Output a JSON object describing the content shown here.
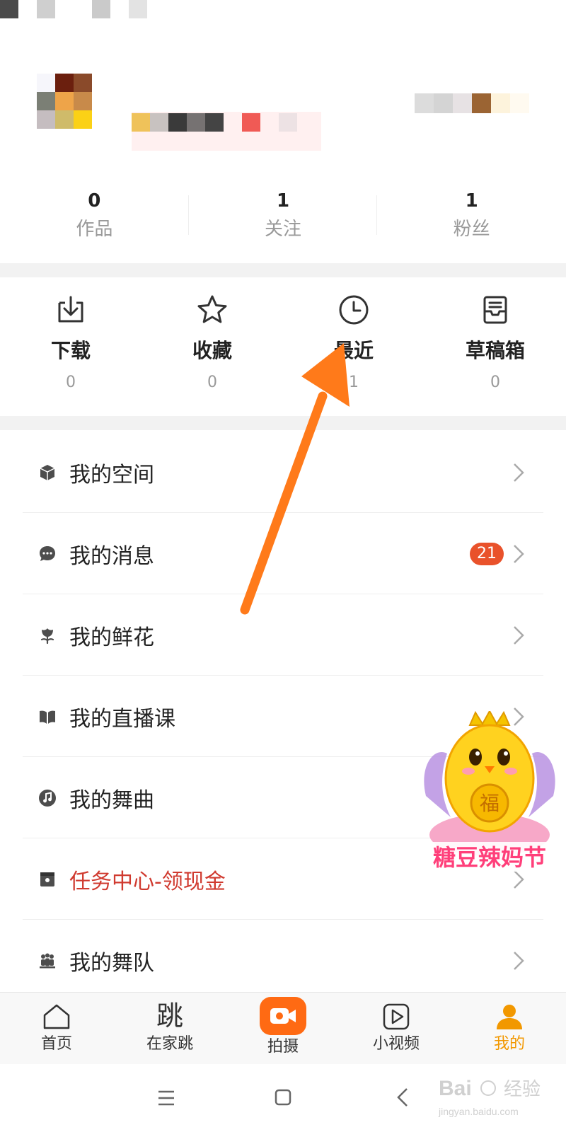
{
  "profile": {
    "stats": [
      {
        "value": "0",
        "label": "作品"
      },
      {
        "value": "1",
        "label": "关注"
      },
      {
        "value": "1",
        "label": "粉丝"
      }
    ]
  },
  "quick_actions": [
    {
      "label": "下载",
      "count": "0",
      "icon": "download-icon"
    },
    {
      "label": "收藏",
      "count": "0",
      "icon": "star-icon"
    },
    {
      "label": "最近",
      "count": "1",
      "icon": "clock-icon"
    },
    {
      "label": "草稿箱",
      "count": "0",
      "icon": "drafts-icon"
    }
  ],
  "menu": [
    {
      "label": "我的空间",
      "icon": "cube-icon"
    },
    {
      "label": "我的消息",
      "icon": "chat-icon",
      "badge": "21"
    },
    {
      "label": "我的鲜花",
      "icon": "flower-icon"
    },
    {
      "label": "我的直播课",
      "icon": "book-icon"
    },
    {
      "label": "我的舞曲",
      "icon": "music-icon"
    },
    {
      "label": "任务中心-领现金",
      "icon": "task-icon",
      "highlight_color": "#d03a2f"
    },
    {
      "label": "我的舞队",
      "icon": "team-icon"
    }
  ],
  "tabbar": [
    {
      "label": "首页",
      "icon": "home-icon"
    },
    {
      "label": "在家跳",
      "icon": "jump-glyph-icon",
      "glyph": "跳"
    },
    {
      "label": "拍摄",
      "icon": "camera-icon"
    },
    {
      "label": "小视频",
      "icon": "play-icon"
    },
    {
      "label": "我的",
      "icon": "user-icon",
      "active": true
    }
  ],
  "mascot": {
    "caption": "糖豆辣妈节"
  },
  "watermark": {
    "brand": "Bai",
    "brand2": "经验",
    "url": "jingyan.baidu.com"
  },
  "colors": {
    "accent": "#f29800",
    "shoot_button": "#ff6a13",
    "badge": "#e9522b",
    "arrow": "#ff7a1a"
  }
}
